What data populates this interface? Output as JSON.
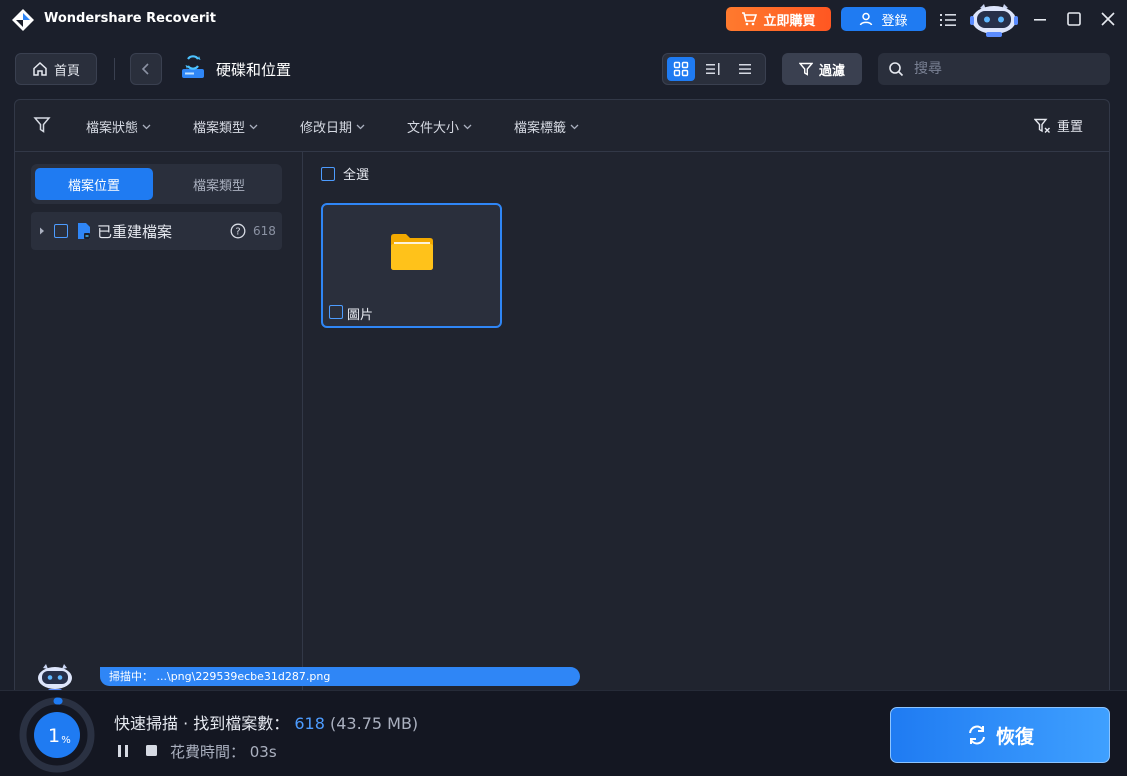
{
  "titlebar": {
    "app_name": "Wondershare Recoverit",
    "buy_label": "立即購買",
    "login_label": "登錄"
  },
  "nav": {
    "home_label": "首頁",
    "page_title": "硬碟和位置",
    "filter_label": "過濾",
    "search_placeholder": "搜尋"
  },
  "filter_bar": {
    "dropdowns": [
      "檔案狀態",
      "檔案類型",
      "修改日期",
      "文件大小",
      "檔案標籤"
    ],
    "reset_label": "重置"
  },
  "left_pane": {
    "tabs": [
      "檔案位置",
      "檔案類型"
    ],
    "tree": [
      {
        "label": "已重建檔案",
        "count": "618"
      }
    ]
  },
  "main": {
    "select_all_label": "全選",
    "files": [
      {
        "label": "圖片"
      }
    ]
  },
  "scan": {
    "current_path": "掃描中： ...\\png\\229539ecbe31d287.png",
    "status_prefix": "快速掃描 · 找到檔案數：",
    "found_count": "618",
    "found_size": "(43.75 MB)",
    "progress_value": "1",
    "progress_unit": "%",
    "progress_fraction": 0.01,
    "elapsed_label": "花費時間： 03s",
    "recover_label": "恢復"
  },
  "colors": {
    "accent": "#1f7bf2",
    "buy": "#ff5722",
    "background": "#1b1f2b"
  }
}
